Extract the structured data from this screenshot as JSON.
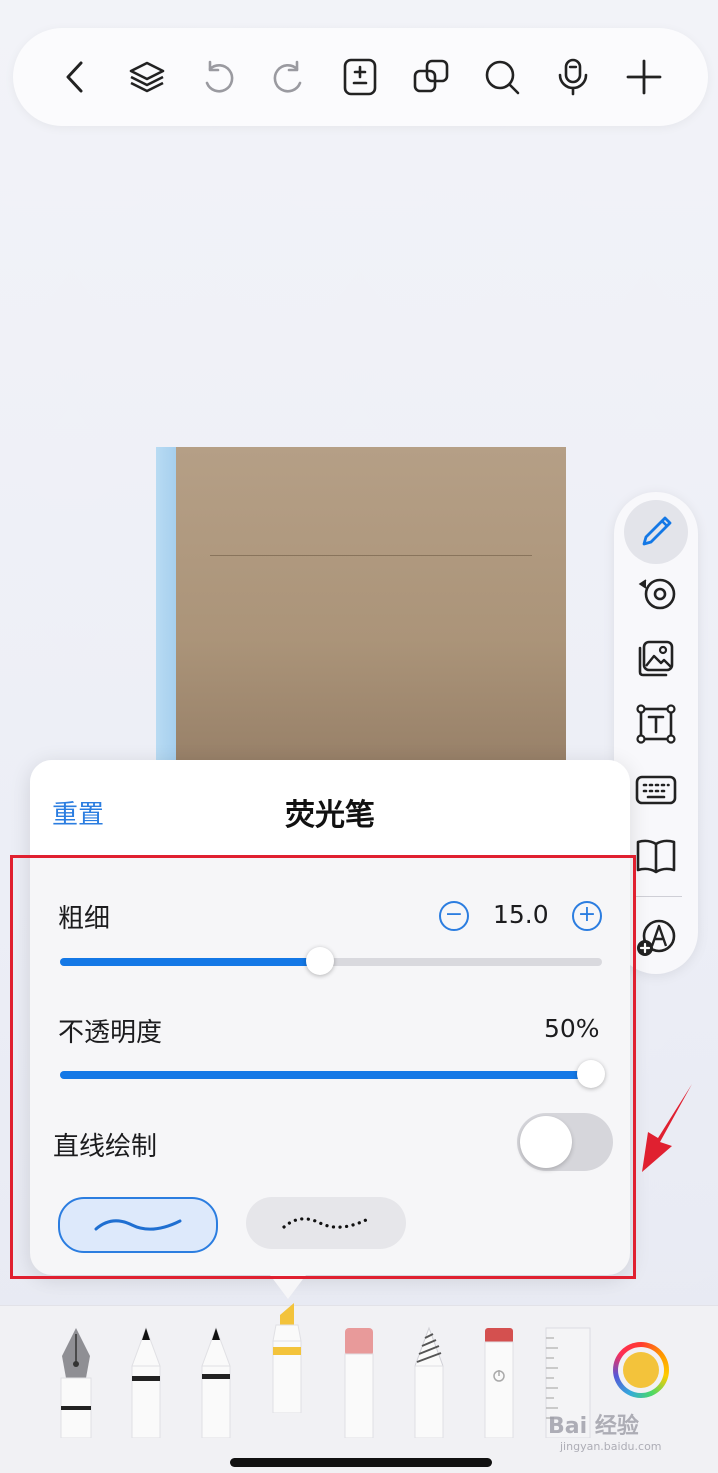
{
  "toolbar": {
    "icons": [
      "back-icon",
      "layers-icon",
      "undo-icon",
      "redo-icon",
      "page-add-icon",
      "duplicate-icon",
      "search-icon",
      "microphone-icon",
      "plus-icon"
    ]
  },
  "sidebar": {
    "icons": [
      "pen-icon",
      "tape-icon",
      "image-icon",
      "text-box-icon",
      "keyboard-icon",
      "book-icon",
      "add-style-icon"
    ],
    "active": "pen-icon"
  },
  "panel": {
    "reset_label": "重置",
    "title": "荧光笔",
    "thickness": {
      "label": "粗细",
      "value": "15.0",
      "fraction": 0.48
    },
    "opacity": {
      "label": "不透明度",
      "value": "50%",
      "fraction": 0.98
    },
    "straight_line": {
      "label": "直线绘制",
      "enabled": false
    },
    "stroke_styles": [
      "solid-wave",
      "dotted-wave"
    ],
    "selected_style": "solid-wave"
  },
  "tools": [
    "fountain-pen",
    "pen",
    "pencil",
    "highlighter",
    "eraser",
    "lasso",
    "spray",
    "ruler",
    "color-picker"
  ],
  "selected_tool": "highlighter",
  "colors": {
    "accent": "#2b7de0",
    "highlighter": "#f3c33b",
    "annotation": "#e02030",
    "current_color": "#f3c33b"
  },
  "watermark": {
    "text": "Bai 经验",
    "sub": "jingyan.baidu.com"
  }
}
